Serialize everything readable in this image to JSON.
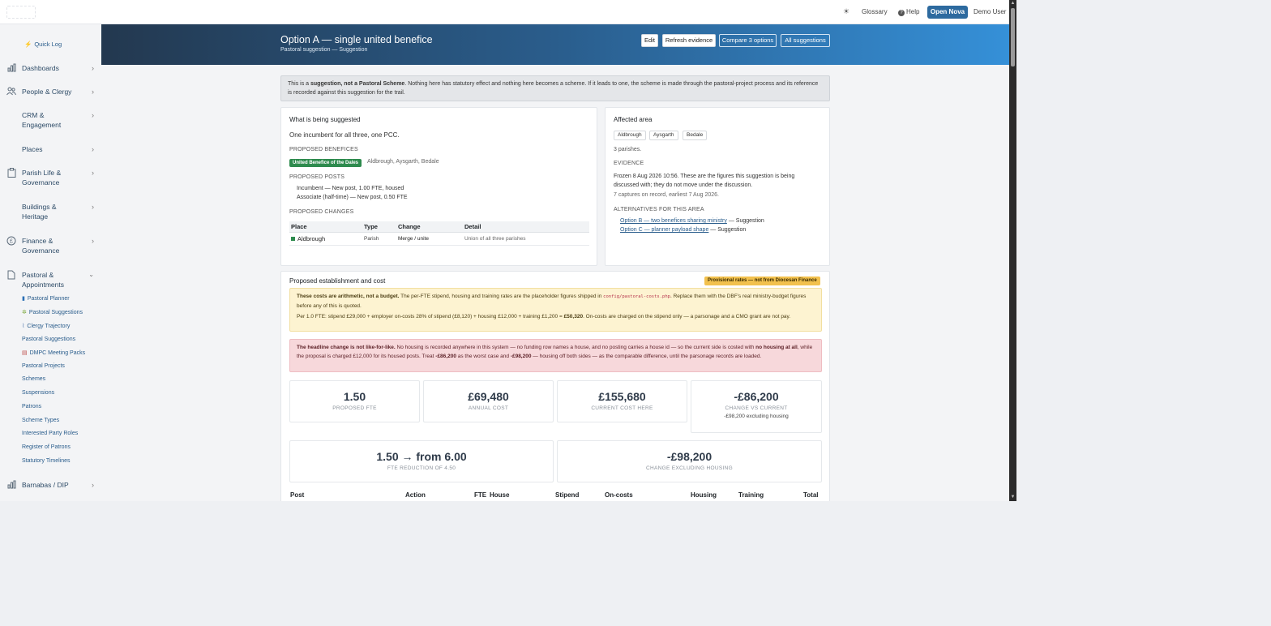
{
  "topbar": {
    "theme_icon": "sun-icon",
    "glossary": "Glossary",
    "help": "Help",
    "open_nova": "Open Nova",
    "user": "Demo User"
  },
  "sidebar": {
    "quick_log": "Quick Log",
    "items": [
      {
        "label": "Dashboards",
        "icon": "bar-chart-icon"
      },
      {
        "label": "People & Clergy",
        "icon": "people-icon"
      },
      {
        "label": "CRM & Engagement",
        "icon": ""
      },
      {
        "label": "Places",
        "icon": ""
      },
      {
        "label": "Parish Life & Governance",
        "icon": "clipboard-icon"
      },
      {
        "label": "Buildings & Heritage",
        "icon": ""
      },
      {
        "label": "Finance & Governance",
        "icon": "pound-icon"
      },
      {
        "label": "Pastoral & Appointments",
        "icon": "document-icon"
      },
      {
        "label": "Barnabas / DIP",
        "icon": "bar-chart-icon"
      }
    ],
    "sub_items": [
      "Pastoral Planner",
      "Pastoral Suggestions",
      "Clergy Trajectory",
      "Pastoral Suggestions",
      "DMPC Meeting Packs",
      "Pastoral Projects",
      "Schemes",
      "Suspensions",
      "Patrons",
      "Scheme Types",
      "Interested Party Roles",
      "Register of Patrons",
      "Statutory Timelines"
    ]
  },
  "header": {
    "title": "Option A — single united benefice",
    "subtitle": "Pastoral suggestion — Suggestion",
    "buttons": {
      "edit": "Edit",
      "refresh": "Refresh evidence",
      "compare": "Compare 3 options",
      "all": "All suggestions"
    }
  },
  "notice": {
    "pre": "This is a ",
    "bold": "suggestion, not a Pastoral Scheme",
    "post": ". Nothing here has statutory effect and nothing here becomes a scheme. If it leads to one, the scheme is made through the pastoral-project process and its reference is recorded against this suggestion for the trail."
  },
  "suggested": {
    "heading": "What is being suggested",
    "summary": "One incumbent for all three, one PCC.",
    "benefices_label": "PROPOSED BENEFICES",
    "benefice_name": "United Benefice of the Dales",
    "benefice_parishes": "Aldbrough, Aysgarth, Bedale",
    "posts_label": "PROPOSED POSTS",
    "posts": [
      "Incumbent — New post, 1.00 FTE, housed",
      "Associate (half-time) — New post, 0.50 FTE"
    ],
    "changes_label": "PROPOSED CHANGES",
    "changes_columns": [
      "Place",
      "Type",
      "Change",
      "Detail"
    ],
    "changes_rows": [
      {
        "place": "Aldbrough",
        "type": "Parish",
        "change": "Merge / unite",
        "detail": "Union of all three parishes"
      }
    ]
  },
  "affected": {
    "heading": "Affected area",
    "chips": [
      "Aldbrough",
      "Aysgarth",
      "Bedale"
    ],
    "count": "3 parishes.",
    "evidence_label": "EVIDENCE",
    "evidence_text": "Frozen 8 Aug 2026 10:56. These are the figures this suggestion is being discussed with; they do not move under the discussion.",
    "evidence_captures": "7 captures on record, earliest 7 Aug 2026.",
    "alternatives_label": "ALTERNATIVES FOR THIS AREA",
    "alternatives": [
      {
        "link": "Option B — two benefices sharing ministry",
        "status": " — Suggestion"
      },
      {
        "link": "Option C — planner payload shape",
        "status": " — Suggestion"
      }
    ]
  },
  "establishment": {
    "heading": "Proposed establishment and cost",
    "badge": "Provisional rates — not from Diocesan Finance",
    "warn1_bold": "These costs are arithmetic, not a budget.",
    "warn1_text": " The per-FTE stipend, housing and training rates are the placeholder figures shipped in ",
    "warn1_code": "config/pastoral-costs.php",
    "warn1_text2": ". Replace them with the DBF's real ministry-budget figures before any of this is quoted.",
    "warn1_line2_pre": "Per 1.0 FTE: stipend £29,000 + employer on-costs 28% of stipend (£8,120) + housing £12,000 + training £1,200 = ",
    "warn1_line2_bold": "£50,320",
    "warn1_line2_post": ". On-costs are charged on the stipend only — a parsonage and a CMO grant are not pay.",
    "warn2_bold": "The headline change is not like-for-like.",
    "warn2_text": " No housing is recorded anywhere in this system — no funding row names a house, and no posting carries a house id — so the current side is costed with ",
    "warn2_bold2": "no housing at all",
    "warn2_text2": ", while the proposal is charged £12,000 for its housed posts. Treat ",
    "warn2_bold3": "-£86,200",
    "warn2_text3": " as the worst case and ",
    "warn2_bold4": "-£98,200",
    "warn2_text4": " — housing off both sides — as the comparable difference, until the parsonage records are loaded.",
    "stats": [
      {
        "value": "1.50",
        "label": "PROPOSED FTE"
      },
      {
        "value": "£69,480",
        "label": "ANNUAL COST"
      },
      {
        "value": "£155,680",
        "label": "CURRENT COST HERE"
      },
      {
        "value": "-£86,200",
        "label": "CHANGE VS CURRENT",
        "note": "-£98,200 excluding housing"
      }
    ],
    "stats2": [
      {
        "value": "1.50 → from 6.00",
        "label": "FTE REDUCTION OF 4.50"
      },
      {
        "value": "-£98,200",
        "label": "CHANGE EXCLUDING HOUSING"
      }
    ],
    "cost_columns": [
      "Post",
      "Action",
      "FTE",
      "House",
      "Stipend",
      "On-costs",
      "Housing",
      "Training",
      "Total"
    ]
  }
}
